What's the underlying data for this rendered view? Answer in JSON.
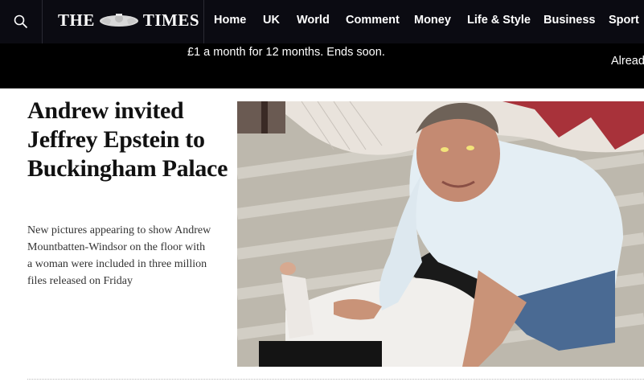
{
  "nav": {
    "logo_text_left": "THE",
    "logo_text_right": "TIMES",
    "items": [
      {
        "label": "Home"
      },
      {
        "label": "UK"
      },
      {
        "label": "World"
      },
      {
        "label": "Comment"
      },
      {
        "label": "Money"
      },
      {
        "label": "Life & Style"
      },
      {
        "label": "Business"
      },
      {
        "label": "Sport"
      }
    ],
    "search_icon": "search-icon"
  },
  "promo": {
    "offer": "£1 a month for 12 months. Ends soon.",
    "cut_text": "Alread"
  },
  "article": {
    "headline": "Andrew invited Jeffrey Epstein to Buckingham Palace",
    "standfirst": "New pictures appearing to show Andrew Mountbatten-Windsor on the floor with a woman were included in three million files released on Friday"
  },
  "colors": {
    "nav_bg": "#0b0b12",
    "promo_bg": "#000000",
    "headline": "#111111"
  }
}
